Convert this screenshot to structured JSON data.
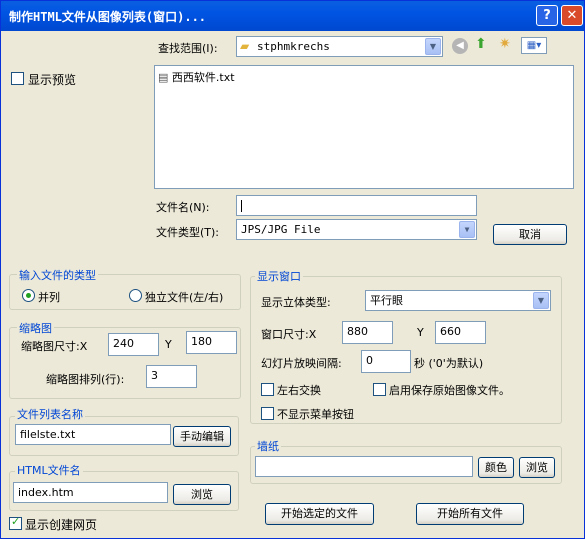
{
  "window": {
    "title": "制作HTML文件从图像列表(窗口)...",
    "help": "?",
    "close": "✕"
  },
  "browser": {
    "lookin_label": "查找范围(I):",
    "lookin_value": "stphmkrechs",
    "files": [
      "西西软件.txt"
    ],
    "filename_label": "文件名(N):",
    "filename_value": "",
    "filetype_label": "文件类型(T):",
    "filetype_value": "JPS/JPG File",
    "cancel": "取消"
  },
  "preview": {
    "label": "显示预览",
    "checked": false
  },
  "input_type": {
    "title": "输入文件的类型",
    "opt_parallel": "并列",
    "opt_separate": "独立文件(左/右)",
    "selected": "并列"
  },
  "thumbnail": {
    "title": "缩略图",
    "size_label": "缩略图尺寸:X",
    "size_x": "240",
    "y_label": "Y",
    "size_y": "180",
    "arrange_label": "缩略图排列(行):",
    "arrange_value": "3"
  },
  "file_list": {
    "title": "文件列表名称",
    "value": "filelste.txt",
    "edit": "手动编辑"
  },
  "html_file": {
    "title": "HTML文件名",
    "value": "index.htm",
    "browse": "浏览"
  },
  "show_create": {
    "label": "显示创建网页",
    "checked": true
  },
  "display": {
    "title": "显示窗口",
    "stereo_label": "显示立体类型:",
    "stereo_value": "平行眼",
    "winsize_label": "窗口尺寸:X",
    "win_x": "880",
    "y_label": "Y",
    "win_y": "660",
    "slide_label": "幻灯片放映间隔:",
    "slide_value": "0",
    "slide_unit": "秒 ('0'为默认)",
    "swap_label": "左右交换",
    "save_label": "启用保存原始图像文件。",
    "nomenu_label": "不显示菜单按钮"
  },
  "wallpaper": {
    "title": "墙纸",
    "value": "",
    "color": "颜色",
    "browse": "浏览"
  },
  "actions": {
    "start_selected": "开始选定的文件",
    "start_all": "开始所有文件"
  }
}
